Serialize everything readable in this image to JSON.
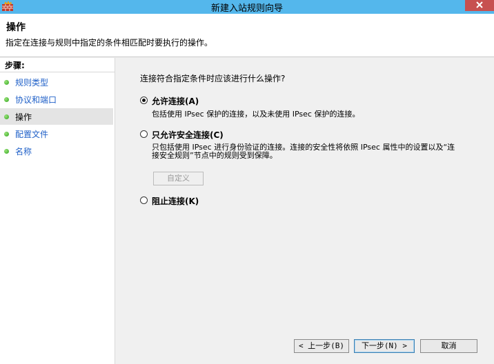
{
  "window": {
    "title": "新建入站规则向导"
  },
  "header": {
    "title": "操作",
    "description": "指定在连接与规则中指定的条件相匹配时要执行的操作。"
  },
  "sidebar": {
    "steps_label": "步骤:",
    "items": [
      {
        "label": "规则类型"
      },
      {
        "label": "协议和端口"
      },
      {
        "label": "操作"
      },
      {
        "label": "配置文件"
      },
      {
        "label": "名称"
      }
    ],
    "active_index": 2
  },
  "main": {
    "question": "连接符合指定条件时应该进行什么操作?",
    "options": [
      {
        "label": "允许连接(A)",
        "description": "包括使用 IPsec 保护的连接，以及未使用 IPsec 保护的连接。",
        "checked": true
      },
      {
        "label": "只允许安全连接(C)",
        "description": "只包括使用 IPsec 进行身份验证的连接。连接的安全性将依照 IPsec 属性中的设置以及“连接安全规则”节点中的规则受到保障。",
        "checked": false
      },
      {
        "label": "阻止连接(K)",
        "description": "",
        "checked": false
      }
    ],
    "customize_label": "自定义"
  },
  "footer": {
    "back_label": "< 上一步(B)",
    "next_label": "下一步(N) >",
    "cancel_label": "取消"
  },
  "colors": {
    "titlebar": "#54b7ec",
    "close": "#c75050",
    "link": "#1f60c8"
  }
}
